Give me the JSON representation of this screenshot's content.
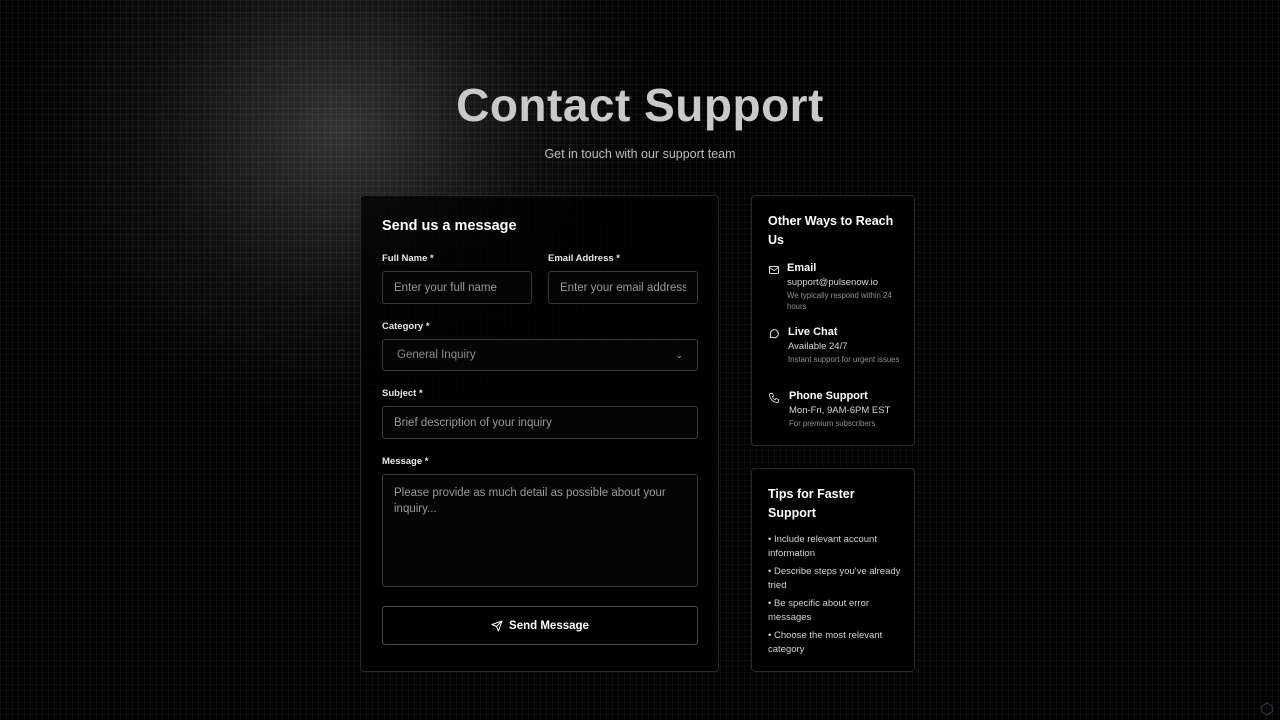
{
  "hero": {
    "title": "Contact Support",
    "subtitle": "Get in touch with our support team"
  },
  "form": {
    "title": "Send us a message",
    "full_name": {
      "label": "Full Name *",
      "placeholder": "Enter your full name",
      "value": ""
    },
    "email": {
      "label": "Email Address *",
      "placeholder": "Enter your email address",
      "value": ""
    },
    "category": {
      "label": "Category *",
      "selected": "General Inquiry"
    },
    "subject": {
      "label": "Subject *",
      "placeholder": "Brief description of your inquiry",
      "value": ""
    },
    "message": {
      "label": "Message *",
      "placeholder": "Please provide as much detail as possible about your inquiry...",
      "value": ""
    },
    "submit_label": "Send Message",
    "submit_icon": "send-icon"
  },
  "reach": {
    "title": "Other Ways to Reach Us",
    "items": [
      {
        "icon": "mail-icon",
        "name": "Email",
        "value": "support@pulsenow.io",
        "note": "We typically respond within 24 hours"
      },
      {
        "icon": "chat-icon",
        "name": "Live Chat",
        "value": "Available 24/7",
        "note": "Instant support for urgent issues"
      },
      {
        "icon": "phone-icon",
        "name": "Phone Support",
        "value": "Mon-Fri, 9AM-6PM EST",
        "note": "For premium subscribers"
      }
    ]
  },
  "tips": {
    "title": "Tips for Faster Support",
    "items": [
      "Include relevant account information",
      "Describe steps you've already tried",
      "Be specific about error messages",
      "Choose the most relevant category"
    ]
  },
  "colors": {
    "background": "#000000",
    "title": "#c9c9c9",
    "border": "#2a2a2a"
  }
}
